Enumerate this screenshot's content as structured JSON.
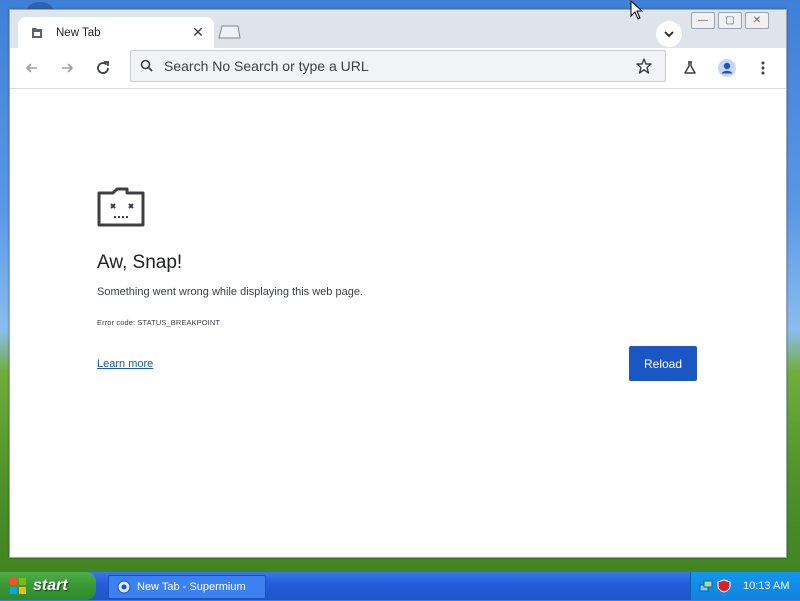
{
  "browser": {
    "tab": {
      "title": "New Tab"
    },
    "omnibox": {
      "placeholder": "Search No Search or type a URL"
    }
  },
  "error_page": {
    "title": "Aw, Snap!",
    "message": "Something went wrong while displaying this web page.",
    "error_code": "Error code: STATUS_BREAKPOINT",
    "learn_more": "Learn more",
    "reload": "Reload"
  },
  "taskbar": {
    "start_label": "start",
    "task_label": "New Tab - Supermium",
    "clock": "10:13 AM"
  },
  "colors": {
    "accent": "#1a56c4",
    "titlebar": "#dfe3ea",
    "taskbar": "#245edb",
    "start": "#3a9a35"
  },
  "icons": {
    "tab": "page-icon",
    "back": "back-arrow-icon",
    "forward": "forward-arrow-icon",
    "reload": "reload-icon",
    "search": "search-icon",
    "bookmark": "star-icon",
    "labs": "flask-icon",
    "profile": "profile-icon",
    "menu": "more-vert-icon",
    "error": "sad-tab-icon"
  }
}
